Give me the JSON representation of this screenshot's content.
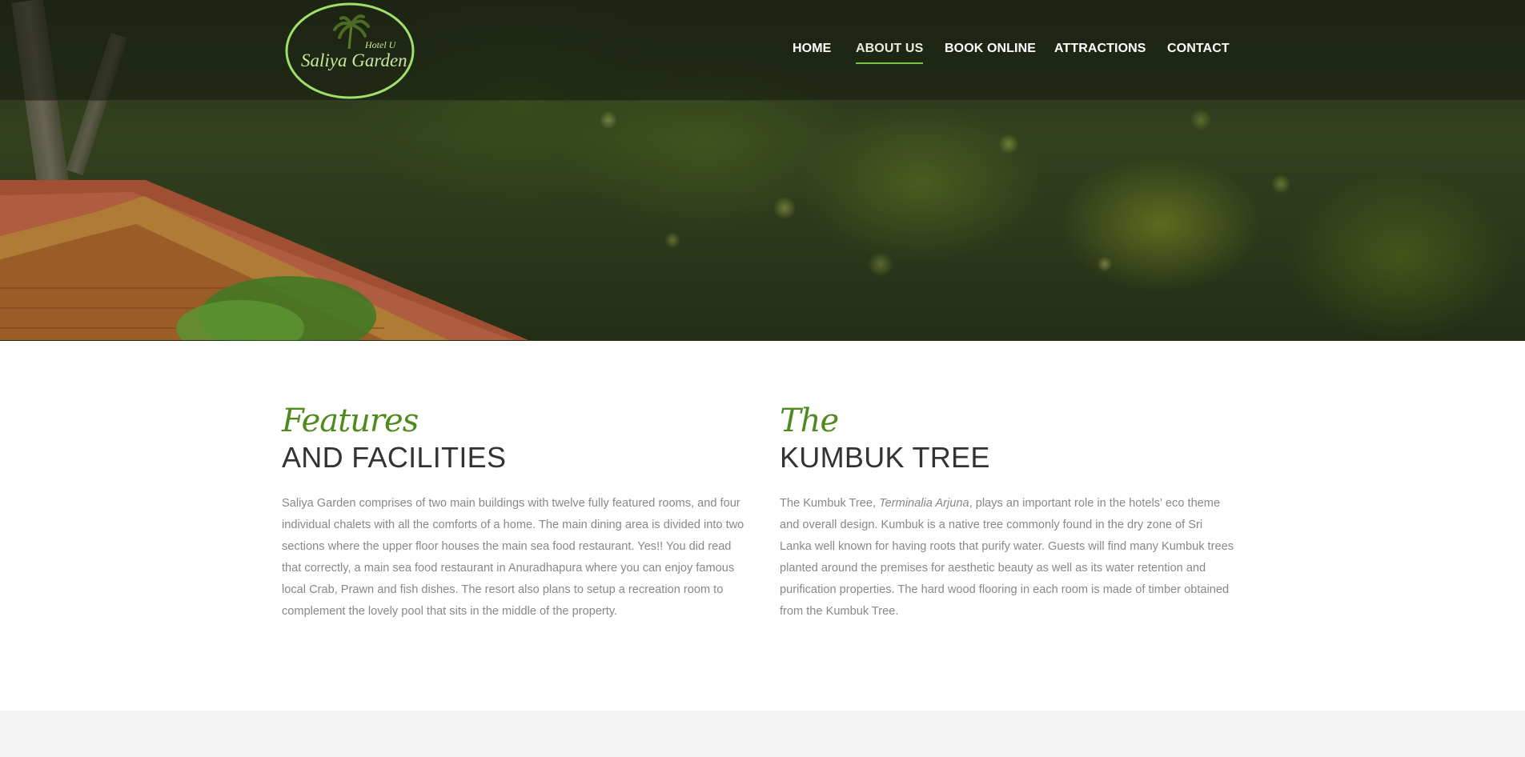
{
  "brand": {
    "name": "Saliya Garden",
    "sub": "Hotel U"
  },
  "nav": {
    "items": [
      "HOME",
      "ABOUT US",
      "BOOK ONLINE",
      "ATTRACTIONS",
      "CONTACT"
    ],
    "active": "ABOUT US"
  },
  "colors": {
    "accent": "#7cc24a",
    "script_green": "#4f8a1e",
    "heading": "#333333",
    "body_text": "#888888"
  },
  "features": {
    "script": "Features",
    "heading": "AND FACILITIES",
    "body": "Saliya Garden comprises of two main buildings with twelve fully featured rooms, and four individual chalets with all the comforts of a home. The main dining area is divided into two sections where the upper floor houses the main sea food restaurant. Yes!! You did read that correctly, a main sea food restaurant in Anuradhapura where you can enjoy famous local Crab, Prawn and fish dishes. The resort also plans to setup a recreation room to complement the lovely pool that sits in the middle of the property."
  },
  "kumbuk": {
    "script": "The",
    "heading": "KUMBUK TREE",
    "body_prefix": "The Kumbuk Tree, ",
    "body_italic": "Terminalia Arjuna",
    "body_suffix": ", plays an important role in the hotels' eco theme and overall design. Kumbuk is a native tree commonly found in the dry zone of Sri Lanka well known for having roots that purify water. Guests will find many Kumbuk trees planted around the premises for aesthetic beauty as well as its water retention and purification properties. The hard wood flooring in each room is made of timber obtained from the Kumbuk Tree."
  }
}
